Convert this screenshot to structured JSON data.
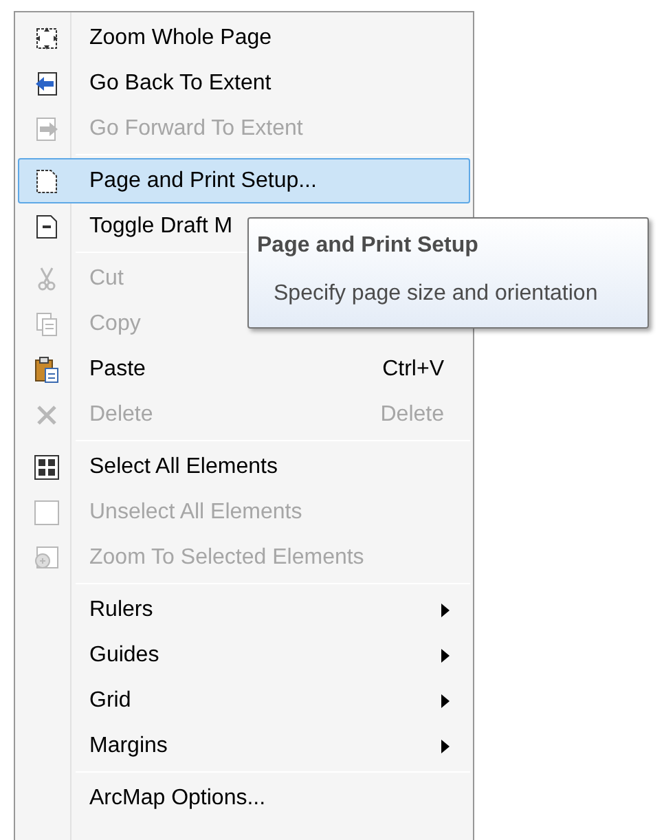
{
  "menu": {
    "groups": [
      [
        {
          "label": "Zoom Whole Page",
          "disabled": false,
          "selected": false,
          "submenu": false
        },
        {
          "label": "Go Back To Extent",
          "disabled": false,
          "selected": false,
          "submenu": false
        },
        {
          "label": "Go Forward To Extent",
          "disabled": true,
          "selected": false,
          "submenu": false
        }
      ],
      [
        {
          "label": "Page and Print Setup...",
          "disabled": false,
          "selected": true,
          "submenu": false
        },
        {
          "label": "Toggle Draft M",
          "disabled": false,
          "selected": false,
          "submenu": false
        }
      ],
      [
        {
          "label": "Cut",
          "disabled": true,
          "selected": false,
          "submenu": false
        },
        {
          "label": "Copy",
          "disabled": true,
          "selected": false,
          "submenu": false
        },
        {
          "label": "Paste",
          "shortcut": "Ctrl+V",
          "disabled": false,
          "selected": false,
          "submenu": false
        },
        {
          "label": "Delete",
          "shortcut": "Delete",
          "disabled": true,
          "selected": false,
          "submenu": false
        }
      ],
      [
        {
          "label": "Select All Elements",
          "disabled": false,
          "selected": false,
          "submenu": false
        },
        {
          "label": "Unselect All Elements",
          "disabled": true,
          "selected": false,
          "submenu": false
        },
        {
          "label": "Zoom To Selected Elements",
          "disabled": true,
          "selected": false,
          "submenu": false
        }
      ],
      [
        {
          "label": "Rulers",
          "disabled": false,
          "selected": false,
          "submenu": true
        },
        {
          "label": "Guides",
          "disabled": false,
          "selected": false,
          "submenu": true
        },
        {
          "label": "Grid",
          "disabled": false,
          "selected": false,
          "submenu": true
        },
        {
          "label": "Margins",
          "disabled": false,
          "selected": false,
          "submenu": true
        }
      ],
      [
        {
          "label": "ArcMap Options...",
          "disabled": false,
          "selected": false,
          "submenu": false
        }
      ]
    ]
  },
  "tooltip": {
    "title": "Page and Print Setup",
    "text": "Specify page size and orientation"
  }
}
